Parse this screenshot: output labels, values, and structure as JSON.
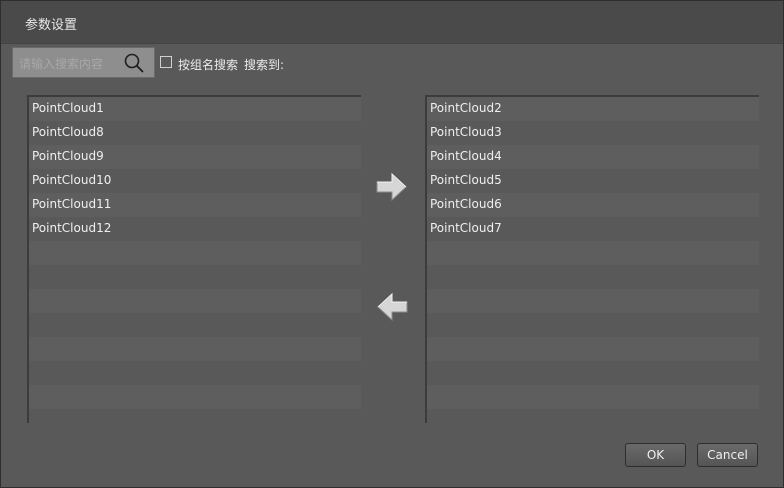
{
  "window": {
    "title": "参数设置"
  },
  "search": {
    "placeholder": "请输入搜索内容",
    "value": ""
  },
  "filter": {
    "checkbox_label": "按组名搜索",
    "checked": false,
    "found_label": "搜索到:"
  },
  "left_list": {
    "items": [
      "PointCloud1",
      "PointCloud8",
      "PointCloud9",
      "PointCloud10",
      "PointCloud11",
      "PointCloud12"
    ]
  },
  "right_list": {
    "items": [
      "PointCloud2",
      "PointCloud3",
      "PointCloud4",
      "PointCloud5",
      "PointCloud6",
      "PointCloud7"
    ]
  },
  "buttons": {
    "ok": "OK",
    "cancel": "Cancel"
  },
  "icons": {
    "search": "search-icon",
    "move_right": "arrow-right-icon",
    "move_left": "arrow-left-icon"
  },
  "colors": {
    "background": "#595959",
    "titlebar": "#4a4a4a",
    "text": "#efefef"
  }
}
